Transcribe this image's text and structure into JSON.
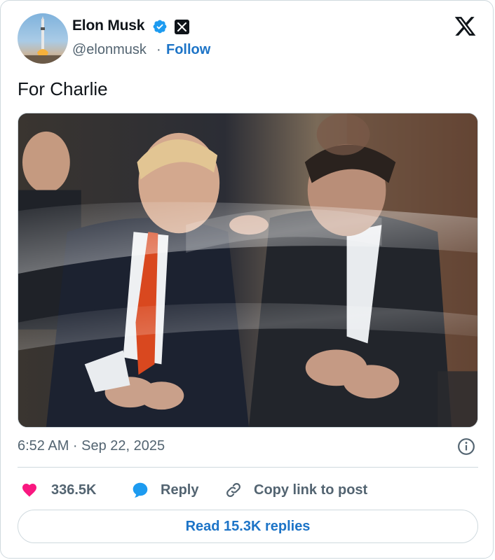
{
  "author": {
    "name": "Elon Musk",
    "handle": "@elonmusk",
    "separator": "·",
    "follow_label": "Follow"
  },
  "tweet": {
    "text": "For Charlie",
    "timestamp": "6:52 AM · Sep 22, 2025"
  },
  "actions": {
    "likes_count": "336.5K",
    "reply_label": "Reply",
    "copy_link_label": "Copy link to post"
  },
  "read_replies_label": "Read 15.3K replies",
  "colors": {
    "accent": "#1d74c7",
    "verified": "#1d9bf0",
    "heart": "#f91880",
    "muted": "#536471",
    "border": "#cfd9de"
  },
  "icons": [
    "verified-badge-icon",
    "x-badge-icon",
    "x-logo-icon",
    "info-icon",
    "heart-icon",
    "reply-bubble-icon",
    "link-icon"
  ]
}
